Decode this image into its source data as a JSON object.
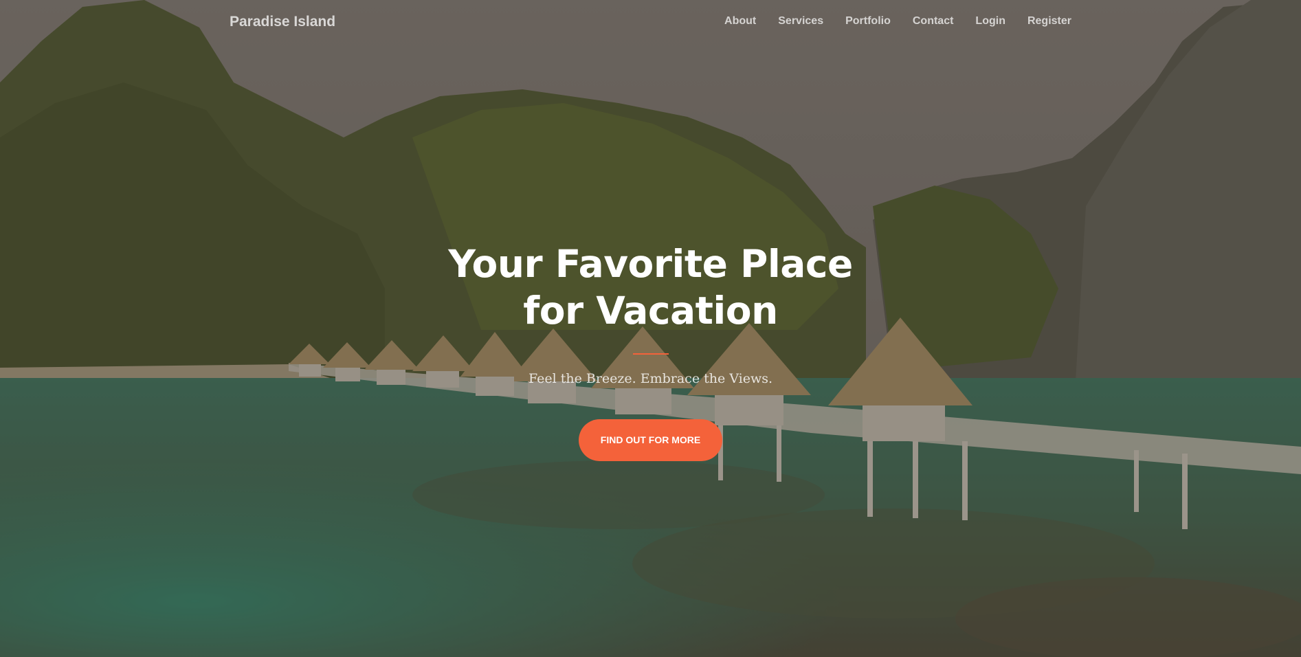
{
  "brand": {
    "name": "Paradise Island"
  },
  "nav": {
    "items": [
      {
        "label": "About"
      },
      {
        "label": "Services"
      },
      {
        "label": "Portfolio"
      },
      {
        "label": "Contact"
      },
      {
        "label": "Login"
      },
      {
        "label": "Register"
      }
    ]
  },
  "hero": {
    "headline": "Your Favorite Place for Vacation",
    "subheading": "Feel the Breeze. Embrace the Views.",
    "cta_label": "FIND OUT FOR MORE"
  },
  "colors": {
    "accent": "#f4623a",
    "heading": "#ffffff",
    "water": "#2f7a63",
    "foliage": "#3e5225"
  }
}
